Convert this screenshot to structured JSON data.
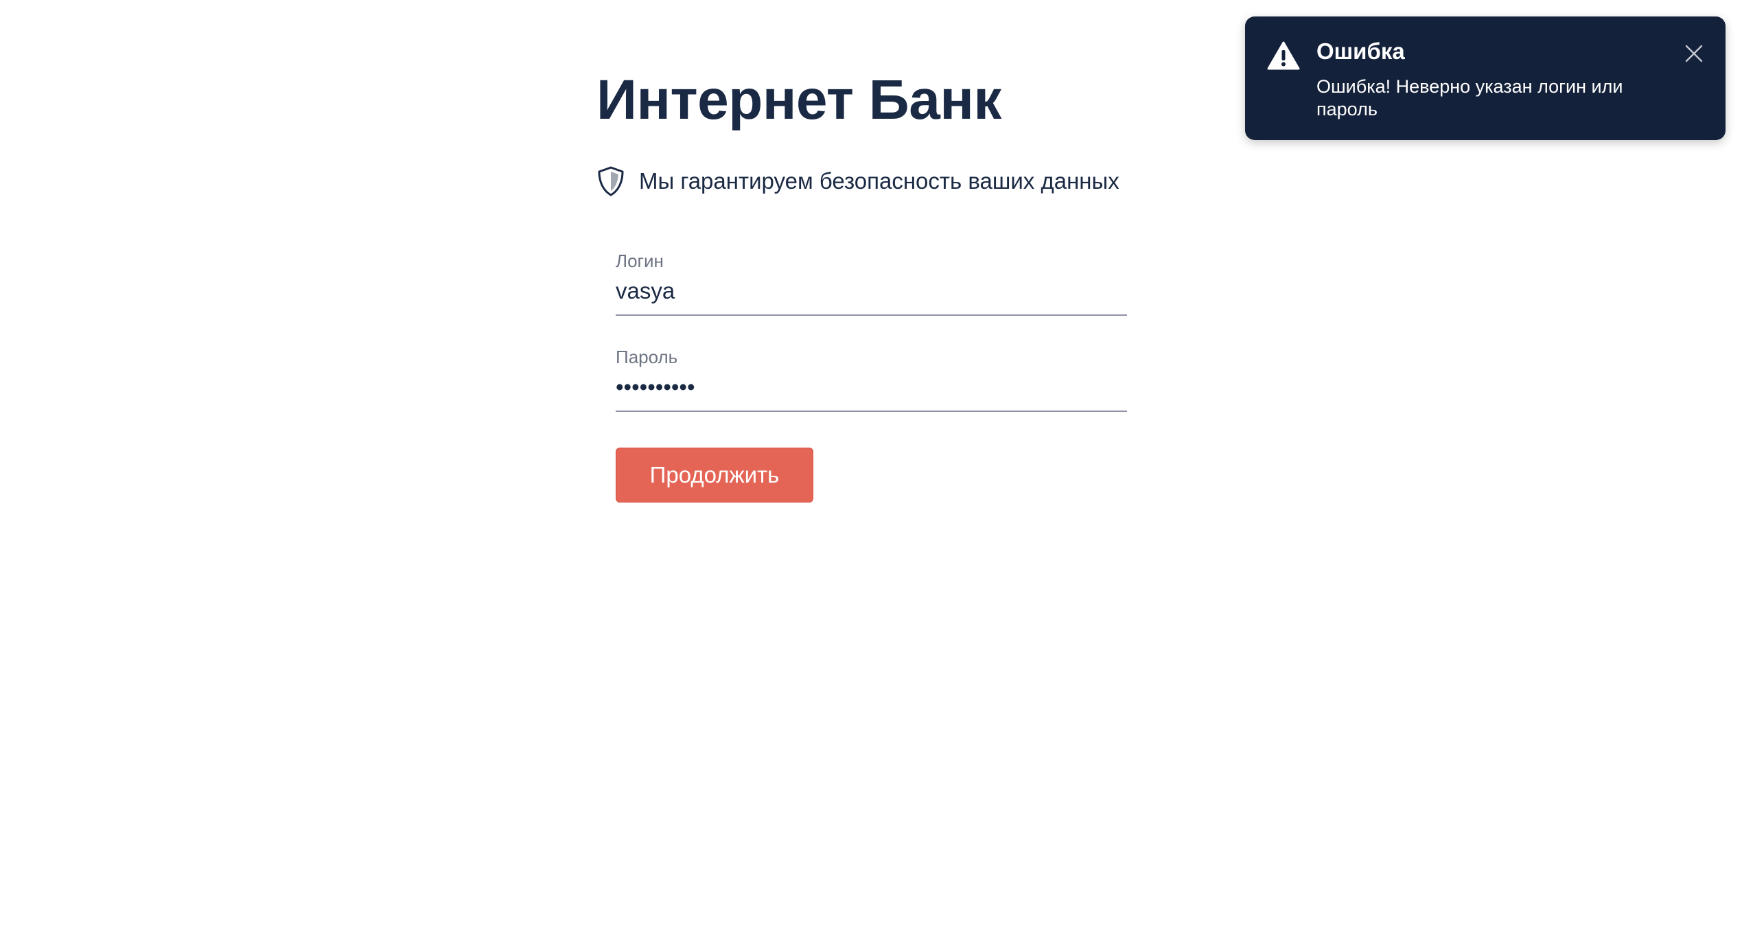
{
  "login_page": {
    "title": "Интернет Банк",
    "security_note": "Мы гарантируем безопасность ваших данных",
    "security_icon": "shield-icon",
    "login_field": {
      "label": "Логин",
      "value": "vasya"
    },
    "password_field": {
      "label": "Пароль",
      "value": "••••••••••"
    },
    "submit_label": "Продолжить"
  },
  "toast": {
    "icon": "warning-icon",
    "title": "Ошибка",
    "message": "Ошибка! Неверно указан логин или пароль",
    "close_icon": "close-icon"
  },
  "colors": {
    "text_primary": "#1b2a44",
    "label_gray": "#6c7382",
    "button_red": "#e46556",
    "toast_background": "#14213a",
    "input_underline": "#8f93a6"
  }
}
